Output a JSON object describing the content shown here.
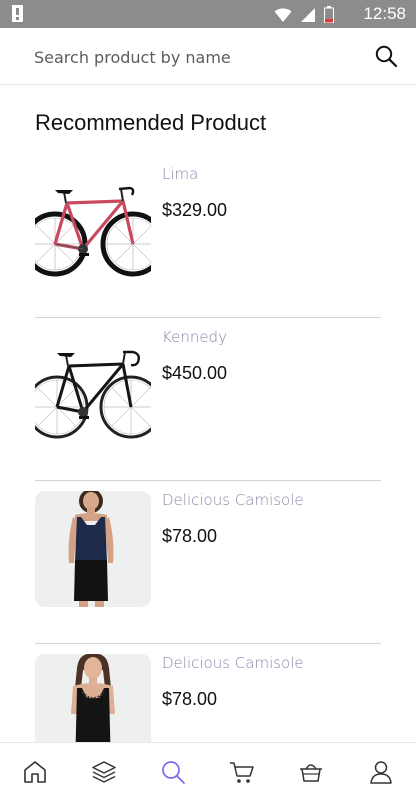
{
  "status_bar": {
    "time": "12:58"
  },
  "search": {
    "placeholder": "Search product by name",
    "value": ""
  },
  "section": {
    "title": "Recommended Product"
  },
  "products": [
    {
      "name": "Lima",
      "price": "$329.00",
      "image": "bicycle-red"
    },
    {
      "name": "Kennedy",
      "price": "$450.00",
      "image": "bicycle-black"
    },
    {
      "name": "Delicious Camisole",
      "price": "$78.00",
      "image": "camisole-navy"
    },
    {
      "name": "Delicious Camisole",
      "price": "$78.00",
      "image": "camisole-black"
    }
  ],
  "bottom_nav": {
    "active": "search",
    "items": [
      "home-icon",
      "layers-icon",
      "search-icon",
      "cart-icon",
      "basket-icon",
      "profile-icon"
    ]
  },
  "colors": {
    "accent": "#7b68ee",
    "product_name": "#8a86a8",
    "status_bar": "#8c8c8c"
  }
}
